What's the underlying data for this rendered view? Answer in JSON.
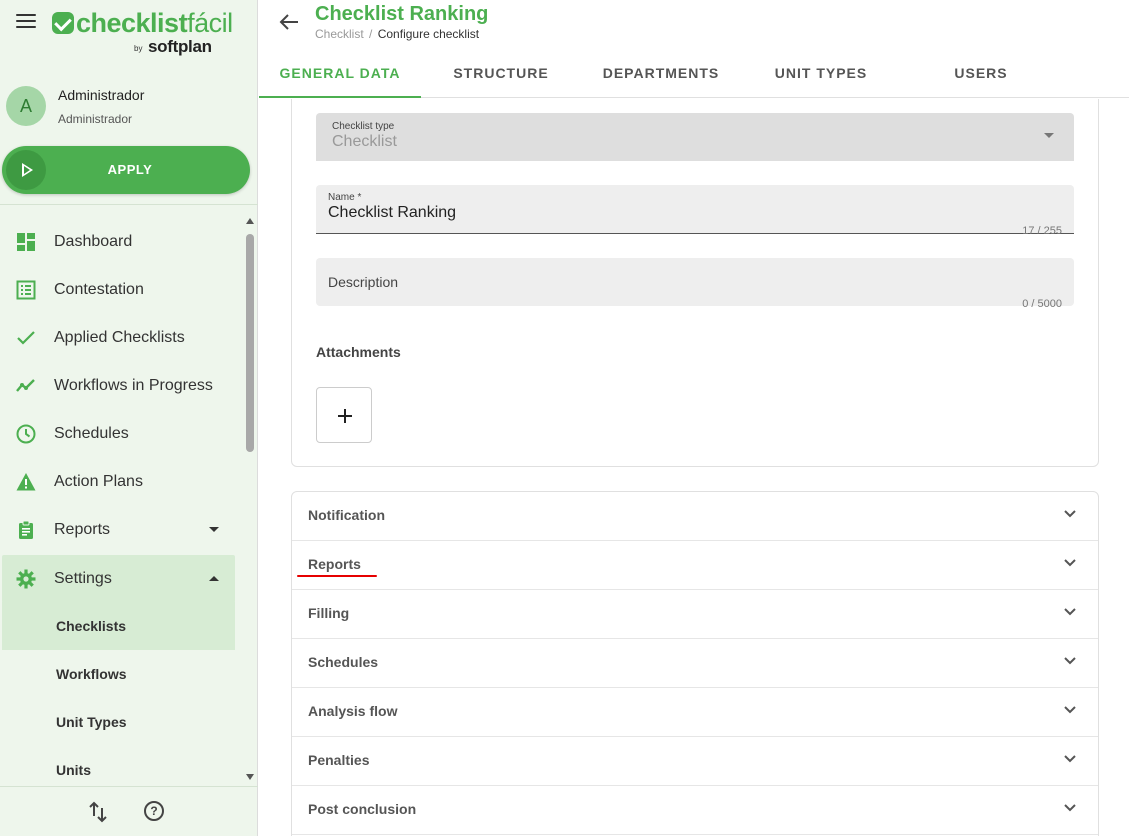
{
  "sidebar": {
    "logo": {
      "brand_bold": "checklist",
      "brand_light": "fácil",
      "by": "by",
      "company": "softplan"
    },
    "user": {
      "initial": "A",
      "name": "Administrador",
      "role": "Administrador"
    },
    "apply_label": "APPLY",
    "nav": [
      {
        "label": "Dashboard",
        "icon": "dashboard-icon"
      },
      {
        "label": "Contestation",
        "icon": "list-icon"
      },
      {
        "label": "Applied Checklists",
        "icon": "check-icon"
      },
      {
        "label": "Workflows in Progress",
        "icon": "trending-icon"
      },
      {
        "label": "Schedules",
        "icon": "clock-icon"
      },
      {
        "label": "Action Plans",
        "icon": "warning-icon"
      },
      {
        "label": "Reports",
        "icon": "clipboard-icon"
      },
      {
        "label": "Settings",
        "icon": "gear-icon"
      }
    ],
    "settings_sub": [
      {
        "label": "Checklists"
      },
      {
        "label": "Workflows"
      },
      {
        "label": "Unit Types"
      },
      {
        "label": "Units"
      }
    ],
    "footer": {
      "help_glyph": "?"
    }
  },
  "header": {
    "title": "Checklist Ranking",
    "breadcrumb": {
      "root": "Checklist",
      "separator": "/",
      "current": "Configure checklist"
    },
    "tabs": [
      {
        "label": "GENERAL DATA"
      },
      {
        "label": "STRUCTURE"
      },
      {
        "label": "DEPARTMENTS"
      },
      {
        "label": "UNIT TYPES"
      },
      {
        "label": "USERS"
      }
    ],
    "active_tab": "GENERAL DATA"
  },
  "form": {
    "checklist_type": {
      "label": "Checklist type",
      "value": "Checklist"
    },
    "name": {
      "label": "Name *",
      "value": "Checklist Ranking",
      "counter": "17 / 255"
    },
    "description": {
      "label": "Description",
      "value": "",
      "counter": "0 / 5000"
    },
    "attachments_label": "Attachments"
  },
  "sections": [
    {
      "label": "Notification"
    },
    {
      "label": "Reports"
    },
    {
      "label": "Filling"
    },
    {
      "label": "Schedules"
    },
    {
      "label": "Analysis flow"
    },
    {
      "label": "Penalties"
    },
    {
      "label": "Post conclusion"
    }
  ],
  "colors": {
    "brand_green": "#4caf50",
    "sidebar_bg": "#eef6ec",
    "active_bg": "#d7ecd4",
    "annotation_red": "#e60000"
  }
}
